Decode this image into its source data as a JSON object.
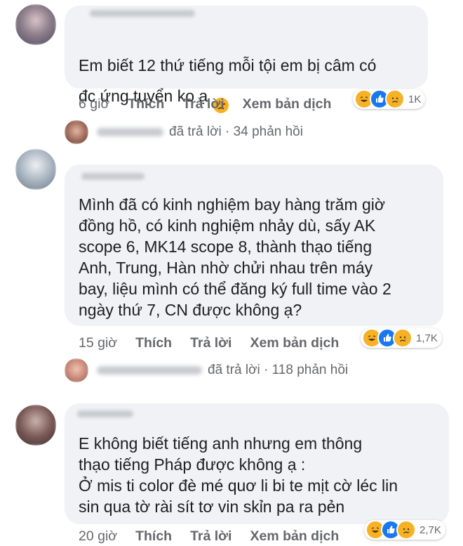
{
  "comments": [
    {
      "text": "Em biết 12 thứ tiếng mỗi tội em bị câm có\nđc ứng tuyển ko ạ",
      "time": "6 giờ",
      "like_label": "Thích",
      "reply_label": "Trả lời",
      "translate_label": "Xem bản dịch",
      "reaction_count": "1K",
      "reply_summary": "đã trả lời · 34 phản hồi"
    },
    {
      "text": "Mình đã có kinh nghiệm bay hàng trăm giờ\nđồng hồ, có kinh nghiệm nhảy dù, sấy AK\nscope 6, MK14 scope 8, thành thạo tiếng\nAnh, Trung, Hàn nhờ chửi nhau trên máy\nbay, liệu mình có thể đăng ký full time vào 2\nngày thứ 7, CN được không ạ?",
      "time": "15 giờ",
      "like_label": "Thích",
      "reply_label": "Trả lời",
      "translate_label": "Xem bản dịch",
      "reaction_count": "1,7K",
      "reply_summary": "đã trả lời · 118 phản hồi"
    },
    {
      "text": "E không biết tiếng anh nhưng em thông\nthạo tiếng Pháp được không ạ :\nỞ mis ti color đè mé quơ li bi te mịt cờ léc lin\nsin qua tờ rài sít tơ vin skỉn pa ra pẻn",
      "time": "20 giờ",
      "like_label": "Thích",
      "reply_label": "Trả lời",
      "translate_label": "Xem bản dịch",
      "reaction_count": "2,7K"
    }
  ],
  "colors": {
    "bubble": "#f0f2f5",
    "muted_text": "#65676b",
    "like_blue": "#1877f2",
    "emoji_yellow": "#f7b125"
  }
}
